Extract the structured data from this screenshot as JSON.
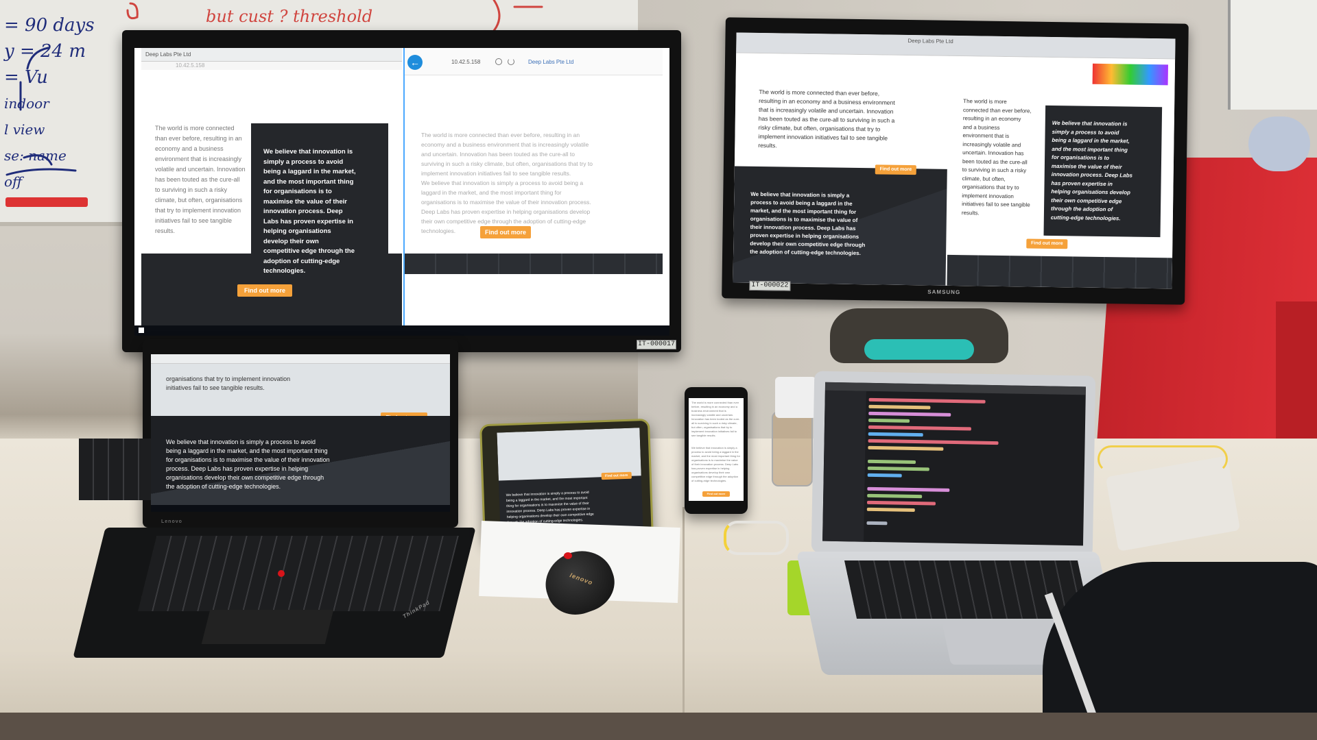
{
  "whiteboard": {
    "notes_left": [
      "= 90 days",
      "y = 24 m",
      "= Vu",
      "indoor",
      "l view",
      "se: name",
      "off"
    ],
    "note_top_red": "but cust ? threshold"
  },
  "website": {
    "owner": "Deep Labs Pte Ltd",
    "tab_title": "Deep Labs Pte Ltd",
    "url": "10.42.5.158",
    "intro_paragraph": "The world is more connected than ever before, resulting in an economy and a business environment that is increasingly volatile and uncertain. Innovation has been touted as the cure-all to surviving in such a risky climate, but often, organisations that try to implement innovation initiatives fail to see tangible results.",
    "belief_paragraph": "We believe that innovation is simply a process to avoid being a laggard in the market, and the most important thing for organisations is to maximise the value of their innovation process. Deep Labs has proven expertise in helping organisations develop their own competitive edge through the adoption of cutting-edge technologies.",
    "cta_label": "Find out more",
    "laptop_intro_snippet": "organisations that try to implement innovation initiatives fail to see tangible results."
  },
  "devices": {
    "monitor_left": {
      "asset_tag": "IT-000017"
    },
    "monitor_right": {
      "asset_tag": "IT-000022",
      "brand": "SAMSUNG"
    },
    "laptop_left": {
      "brand": "ThinkPad",
      "sub_brand": "Lenovo"
    },
    "mouse": {
      "brand": "lenovo"
    },
    "macbook": {
      "editor_theme": "dark"
    }
  },
  "colors": {
    "accent_orange": "#f5a13a",
    "dark_panel": "#25272b",
    "back_button_blue": "#1f8ddc"
  },
  "icons": [
    "back-arrow-icon",
    "refresh-icon",
    "search-icon",
    "windows-start-icon"
  ]
}
